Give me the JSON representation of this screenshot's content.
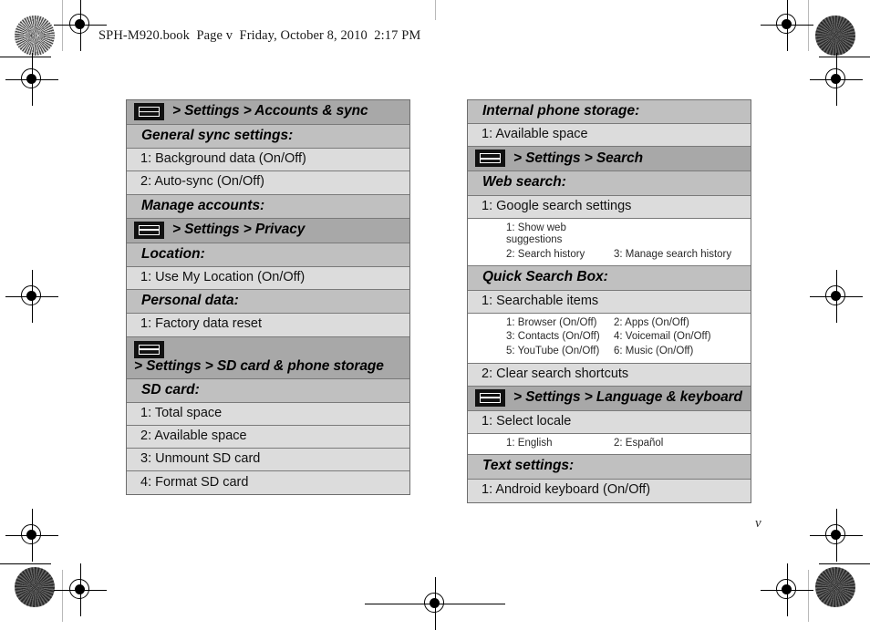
{
  "page": {
    "running_header": "SPH-M920.book  Page v  Friday, October 8, 2010  2:17 PM",
    "folio": "v"
  },
  "icons": {
    "menu_key": "menu-key-icon"
  },
  "left_column": {
    "rows": [
      {
        "type": "path",
        "icon": true,
        "text": "> Settings > Accounts & sync"
      },
      {
        "type": "section",
        "text": "General sync settings:"
      },
      {
        "type": "item",
        "text": "1: Background data (On/Off)"
      },
      {
        "type": "item",
        "text": "2: Auto-sync (On/Off)"
      },
      {
        "type": "section",
        "text": "Manage accounts:"
      },
      {
        "type": "path",
        "icon": true,
        "text": "> Settings > Privacy"
      },
      {
        "type": "section",
        "text": "Location:"
      },
      {
        "type": "item",
        "text": "1: Use My Location (On/Off)"
      },
      {
        "type": "section",
        "text": "Personal data:"
      },
      {
        "type": "item",
        "text": "1: Factory data reset"
      },
      {
        "type": "path",
        "icon": true,
        "text": "> Settings > SD card & phone storage",
        "two_line": true
      },
      {
        "type": "section",
        "text": "SD card:"
      },
      {
        "type": "item",
        "text": "1: Total space"
      },
      {
        "type": "item",
        "text": "2: Available space"
      },
      {
        "type": "item",
        "text": "3: Unmount SD card"
      },
      {
        "type": "item",
        "text": "4: Format SD card"
      }
    ]
  },
  "right_column": {
    "rows": [
      {
        "type": "section",
        "text": "Internal phone storage:"
      },
      {
        "type": "item",
        "text": "1: Available space"
      },
      {
        "type": "path",
        "icon": true,
        "text": "> Settings > Search"
      },
      {
        "type": "section",
        "text": "Web search:"
      },
      {
        "type": "item",
        "text": "1: Google search settings"
      },
      {
        "type": "sub",
        "cells": [
          "1: Show web suggestions",
          "",
          "2: Search history",
          "3: Manage search history"
        ]
      },
      {
        "type": "section",
        "text": "Quick Search Box:"
      },
      {
        "type": "item",
        "text": "1: Searchable items"
      },
      {
        "type": "sub",
        "cells": [
          "1: Browser (On/Off)",
          "2: Apps (On/Off)",
          "3: Contacts (On/Off)",
          "4: Voicemail (On/Off)",
          "5: YouTube (On/Off)",
          "6: Music (On/Off)"
        ]
      },
      {
        "type": "item",
        "text": "2: Clear search shortcuts"
      },
      {
        "type": "path",
        "icon": true,
        "text": "> Settings > Language & keyboard"
      },
      {
        "type": "item",
        "text": "1: Select locale"
      },
      {
        "type": "sub",
        "cells": [
          "1: English",
          "2: Español"
        ]
      },
      {
        "type": "section",
        "text": "Text settings:"
      },
      {
        "type": "item",
        "text": "1: Android keyboard (On/Off)"
      }
    ]
  },
  "colors": {
    "path_row_bg": "#a8a8a8",
    "section_row_bg": "#c0c0c0",
    "item_row_bg": "#dcdcdc",
    "sub_row_bg": "#ffffff",
    "border": "#7a7a7a"
  }
}
